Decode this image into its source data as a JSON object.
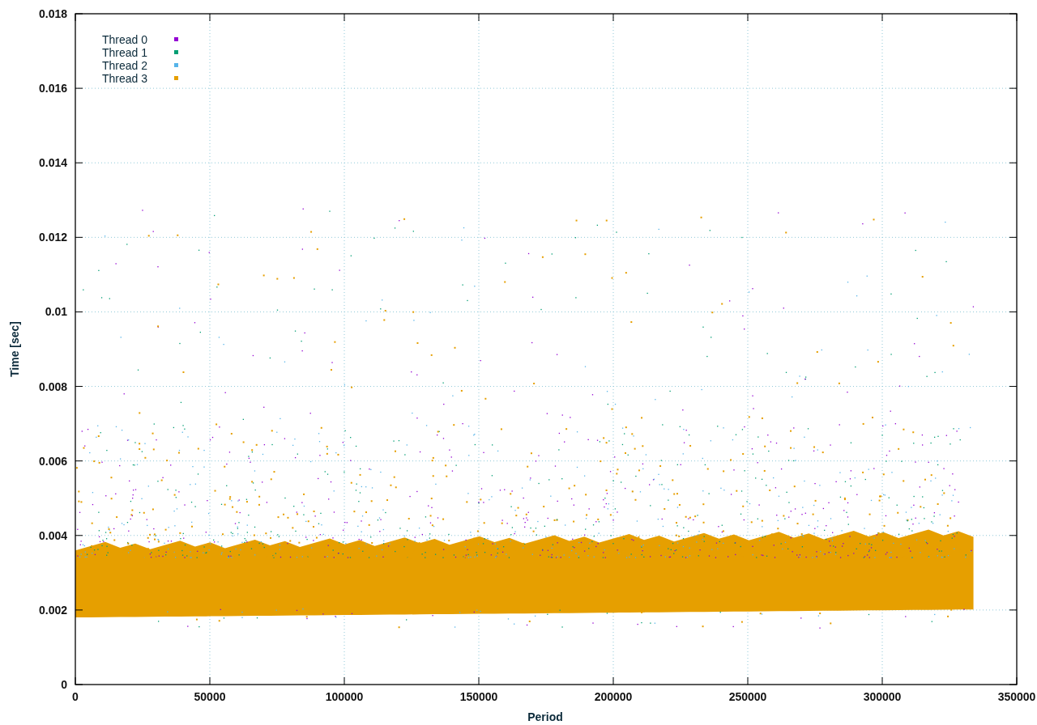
{
  "plot": {
    "y_axis_label": "Time [sec]",
    "x_axis_label": "Period",
    "y_ticks": [
      "0.018",
      "0.016",
      "0.014",
      "0.012",
      "0.01",
      "0.008",
      "0.006",
      "0.004",
      "0.002",
      "0"
    ],
    "x_ticks": [
      "0",
      "50000",
      "100000",
      "150000",
      "200000",
      "250000",
      "300000",
      "350000"
    ],
    "legend": [
      {
        "label": "Thread 0",
        "color": "#9400d3"
      },
      {
        "label": "Thread 1",
        "color": "#009e73"
      },
      {
        "label": "Thread 2",
        "color": "#56b4e9"
      },
      {
        "label": "Thread 3",
        "color": "#e69f00"
      }
    ]
  }
}
